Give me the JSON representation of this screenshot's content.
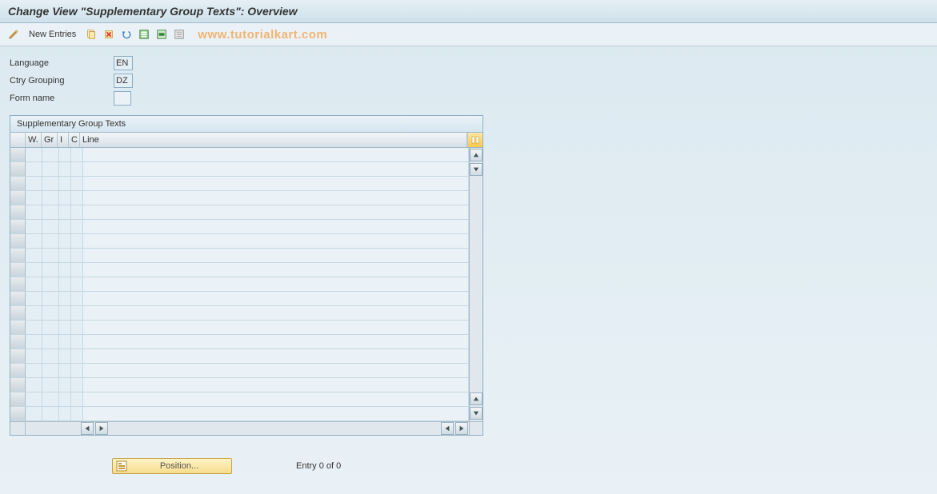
{
  "title": "Change View \"Supplementary Group Texts\": Overview",
  "toolbar": {
    "new_entries_label": "New Entries"
  },
  "watermark": "www.tutorialkart.com",
  "form": {
    "language_label": "Language",
    "language_value": "EN",
    "ctry_grouping_label": "Ctry Grouping",
    "ctry_grouping_value": "DZ",
    "form_name_label": "Form name",
    "form_name_value": ""
  },
  "grid": {
    "title": "Supplementary Group Texts",
    "columns": {
      "w": "W.",
      "gr": "Gr",
      "i": "I",
      "c": "C",
      "line": "Line"
    }
  },
  "footer": {
    "position_label": "Position...",
    "entry_text": "Entry 0 of 0"
  }
}
